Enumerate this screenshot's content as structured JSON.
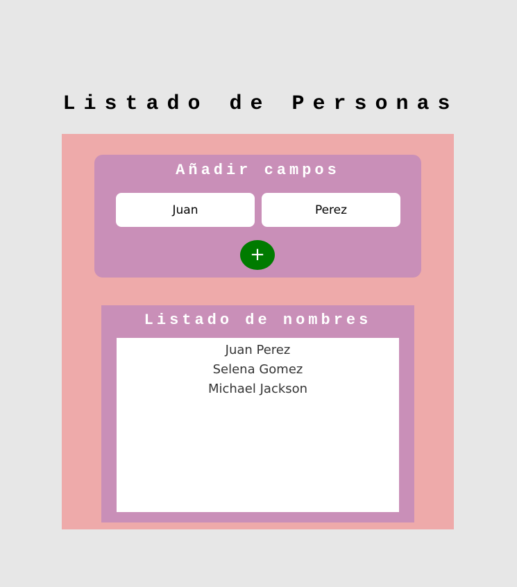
{
  "page": {
    "title": "Listado de Personas"
  },
  "add_form": {
    "title": "Añadir campos",
    "first_name_value": "Juan",
    "last_name_value": "Perez",
    "add_button_label": "+"
  },
  "names_list": {
    "title": "Listado de nombres",
    "items": [
      "Juan Perez",
      "Selena Gomez",
      "Michael Jackson"
    ]
  },
  "colors": {
    "background": "#e7e7e7",
    "panel": "#eeaaaa",
    "card": "#c98fb8",
    "add_button": "#007b00"
  }
}
